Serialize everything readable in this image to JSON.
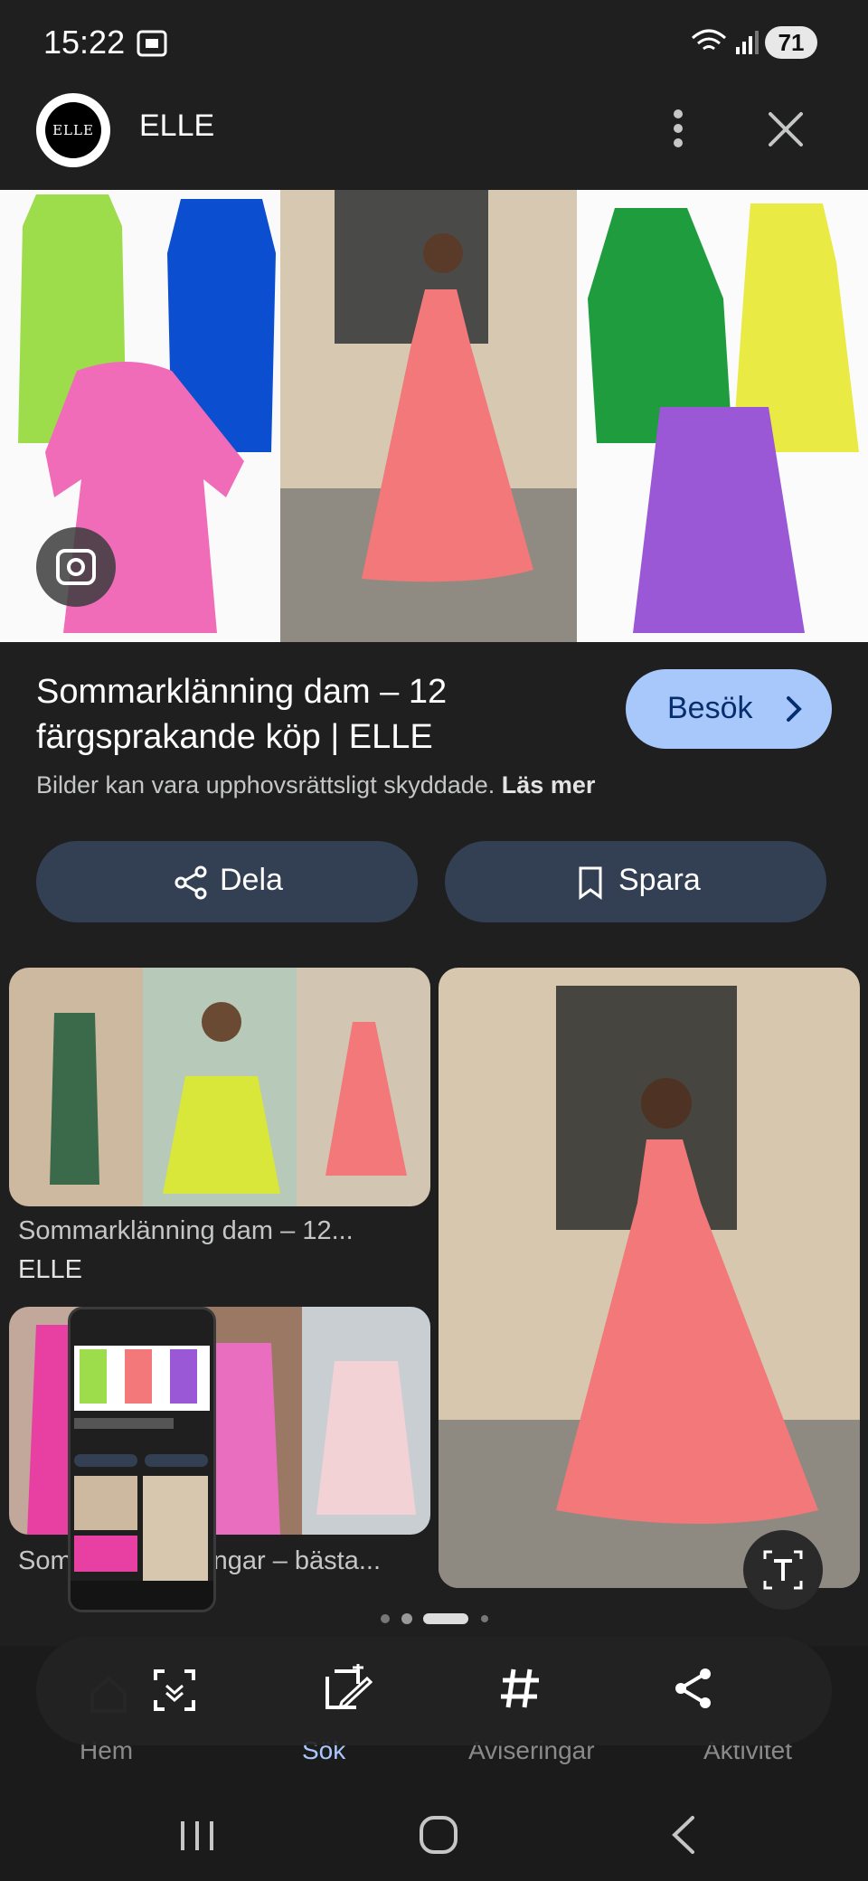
{
  "status_bar": {
    "time": "15:22",
    "battery": "71"
  },
  "header": {
    "source_name": "ELLE",
    "logo_text": "ELLE"
  },
  "result": {
    "title_line1": "Sommarklänning dam – 12",
    "title_line2": "färgsprakande köp | ELLE",
    "visit_label": "Besök",
    "copyright_text": "Bilder kan vara upphovsrättsligt skyddade.",
    "read_more": "Läs mer"
  },
  "actions": {
    "share_label": "Dela",
    "save_label": "Spara"
  },
  "related": [
    {
      "title": "Sommarklänning dam – 12...",
      "source": "ELLE"
    },
    {
      "title": "Som",
      "title_tail": "ngar – bästa..."
    }
  ],
  "bottom_nav": {
    "items": [
      {
        "label": "Hem",
        "icon": "home-icon"
      },
      {
        "label": "Sök",
        "icon": "search-icon"
      },
      {
        "label": "Aviseringar",
        "icon": "bell-icon"
      },
      {
        "label": "Aktivitet",
        "icon": "history-icon"
      }
    ],
    "active": "Sök"
  },
  "toolbar": {
    "items": [
      {
        "icon": "scan-icon"
      },
      {
        "icon": "edit-screenshot-icon"
      },
      {
        "icon": "hashtag-icon"
      },
      {
        "icon": "share-icon"
      }
    ]
  },
  "colors": {
    "visit_bg": "#a8c7fa",
    "pill_bg": "#334054",
    "active_nav": "#a8c7fa"
  }
}
